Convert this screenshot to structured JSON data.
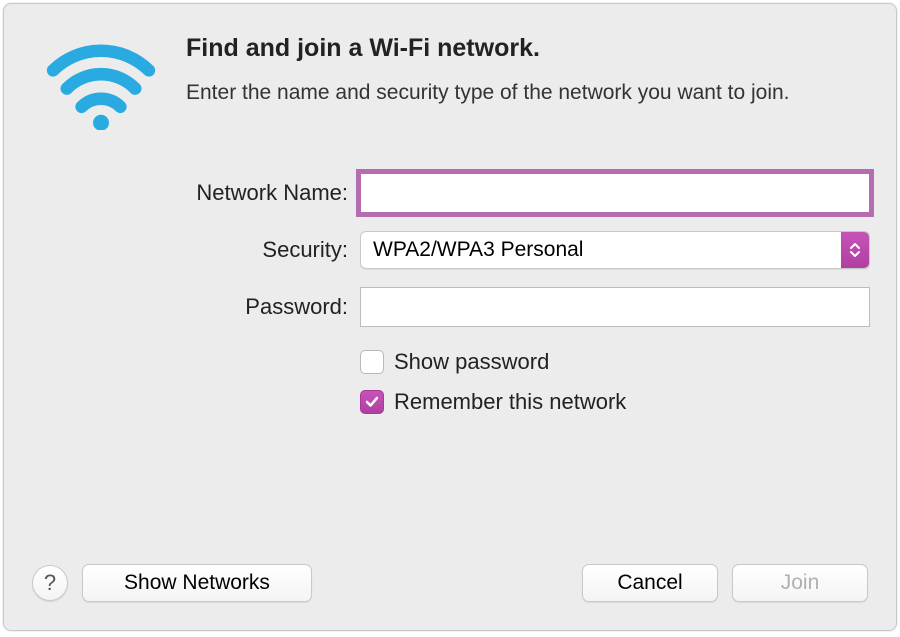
{
  "header": {
    "title": "Find and join a Wi-Fi network.",
    "subtitle": "Enter the name and security type of the network you want to join."
  },
  "form": {
    "network_name_label": "Network Name:",
    "network_name_value": "",
    "security_label": "Security:",
    "security_value": "WPA2/WPA3 Personal",
    "password_label": "Password:",
    "password_value": "",
    "show_password_label": "Show password",
    "show_password_checked": false,
    "remember_network_label": "Remember this network",
    "remember_network_checked": true
  },
  "footer": {
    "help_label": "?",
    "show_networks_label": "Show Networks",
    "cancel_label": "Cancel",
    "join_label": "Join",
    "join_enabled": false
  },
  "colors": {
    "accent": "#b845a8",
    "wifi_icon": "#1ea7e8"
  }
}
